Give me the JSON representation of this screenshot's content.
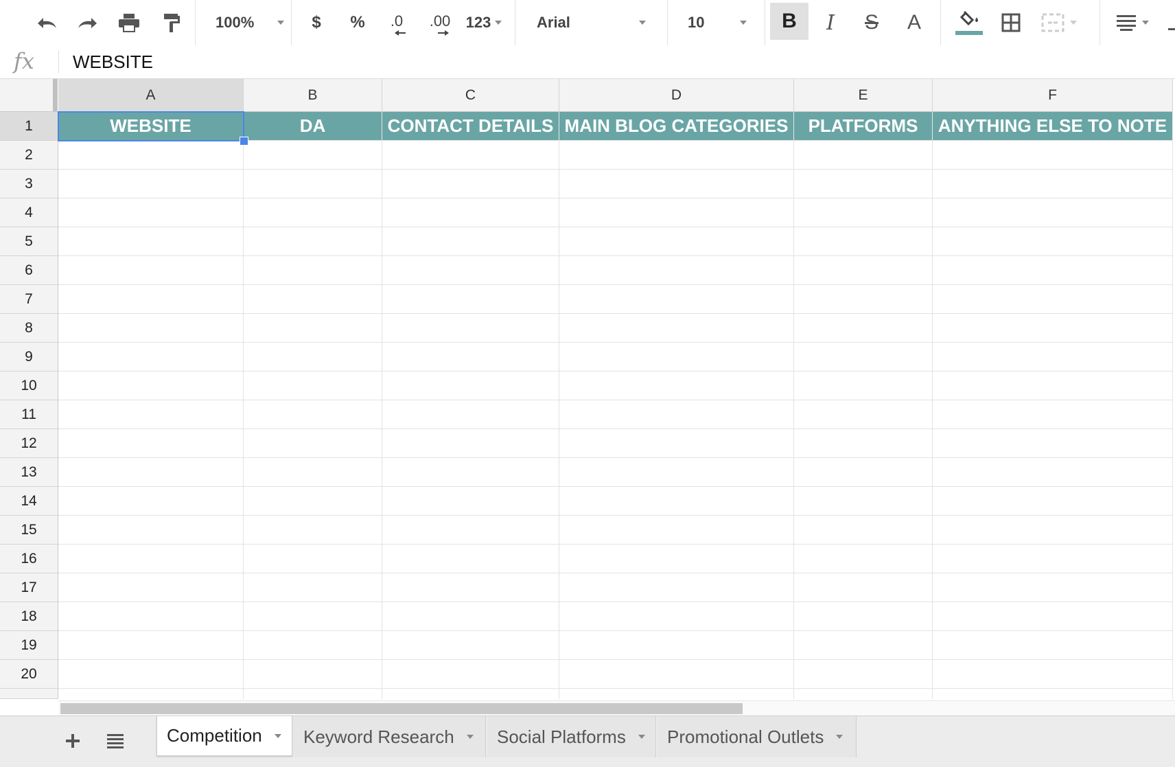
{
  "toolbar": {
    "zoom": "100%",
    "currency": "$",
    "percent": "%",
    "decrease_decimals": ".0",
    "increase_decimals": ".00",
    "more_formats": "123",
    "font": "Arial",
    "font_size": "10",
    "bold": "B",
    "italic": "I",
    "strikethrough": "S",
    "text_color": "A",
    "fill_color": "#6aa5a5"
  },
  "formula_bar": {
    "fx": "fx",
    "value": "WEBSITE"
  },
  "grid": {
    "columns": [
      "A",
      "B",
      "C",
      "D",
      "E",
      "F"
    ],
    "rows": [
      "1",
      "2",
      "3",
      "4",
      "5",
      "6",
      "7",
      "8",
      "9",
      "10",
      "11",
      "12",
      "13",
      "14",
      "15",
      "16",
      "17",
      "18",
      "19",
      "20"
    ],
    "header_row": [
      "WEBSITE",
      "DA",
      "CONTACT DETAILS",
      "MAIN BLOG CATEGORIES",
      "PLATFORMS",
      "ANYTHING ELSE TO NOTE"
    ],
    "selected_cell": "A1",
    "header_color": "#6aa5a5"
  },
  "sheets": {
    "tabs": [
      "Competition",
      "Keyword Research",
      "Social Platforms",
      "Promotional Outlets"
    ],
    "active": "Competition"
  }
}
